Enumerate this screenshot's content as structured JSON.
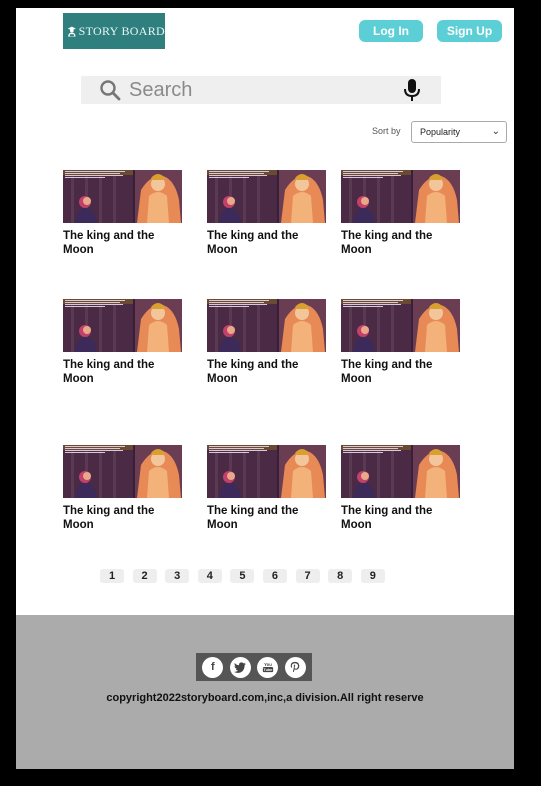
{
  "header": {
    "logo_text": "STORY BOARD",
    "login_label": "Log In",
    "signup_label": "Sign Up"
  },
  "search": {
    "placeholder": "Search"
  },
  "sort": {
    "label": "Sort by",
    "selected": "Popularity"
  },
  "cards": [
    {
      "title": "The king and the Moon"
    },
    {
      "title": "The king and the Moon"
    },
    {
      "title": "The king and the Moon"
    },
    {
      "title": "The king and the Moon"
    },
    {
      "title": "The king and the Moon"
    },
    {
      "title": "The king and the Moon"
    },
    {
      "title": "The king and the Moon"
    },
    {
      "title": "The king and the Moon"
    },
    {
      "title": "The king and the Moon"
    }
  ],
  "pagination": [
    "1",
    "2",
    "3",
    "4",
    "5",
    "6",
    "7",
    "8",
    "9"
  ],
  "footer": {
    "copyright": "copyright2022storyboard.com,inc,a division.All right reserve",
    "social_icons": [
      "facebook-icon",
      "twitter-icon",
      "youtube-icon",
      "pinterest-icon"
    ]
  },
  "colors": {
    "accent": "#5ccfd6",
    "logo_bg": "#2f7f7f",
    "footer_bg": "#ababab"
  }
}
